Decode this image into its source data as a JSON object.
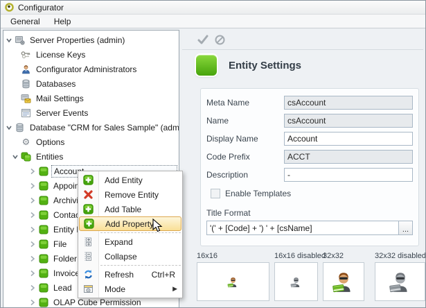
{
  "window": {
    "title": "Configurator"
  },
  "menubar": {
    "items": [
      {
        "label": "General"
      },
      {
        "label": "Help"
      }
    ]
  },
  "tree": {
    "items": [
      {
        "label": "Server Properties (admin)",
        "icon": "server-icon",
        "state": "expanded"
      },
      {
        "label": "License Keys",
        "icon": "keys-icon"
      },
      {
        "label": "Configurator Administrators",
        "icon": "admin-person-icon"
      },
      {
        "label": "Databases",
        "icon": "database-icon"
      },
      {
        "label": "Mail Settings",
        "icon": "mail-settings-icon"
      },
      {
        "label": "Server Events",
        "icon": "server-events-icon"
      },
      {
        "label": "Database \"CRM for Sales Sample\" (admin)",
        "icon": "database-icon",
        "state": "expanded"
      },
      {
        "label": "Options",
        "icon": "gear-icon"
      },
      {
        "label": "Entities",
        "icon": "entities-icon",
        "state": "expanded"
      },
      {
        "label": "Account",
        "icon": "entity-icon",
        "state": "collapsed",
        "selected": true
      },
      {
        "label": "Appoint",
        "icon": "entity-icon",
        "state": "collapsed"
      },
      {
        "label": "Archivin",
        "icon": "entity-icon",
        "state": "collapsed"
      },
      {
        "label": "Contac",
        "icon": "entity-icon",
        "state": "collapsed"
      },
      {
        "label": "Entity P",
        "icon": "entity-icon",
        "state": "collapsed"
      },
      {
        "label": "File",
        "icon": "entity-icon",
        "state": "collapsed"
      },
      {
        "label": "Folder",
        "icon": "entity-icon",
        "state": "collapsed"
      },
      {
        "label": "Invoice",
        "icon": "entity-icon",
        "state": "collapsed"
      },
      {
        "label": "Lead",
        "icon": "entity-icon",
        "state": "collapsed"
      },
      {
        "label": "OLAP Cube Permission",
        "icon": "entity-icon",
        "state": "collapsed"
      }
    ]
  },
  "context_menu": {
    "items": [
      {
        "label": "Add Entity",
        "icon": "add-icon"
      },
      {
        "label": "Remove Entity",
        "icon": "remove-icon"
      },
      {
        "label": "Add Table",
        "icon": "add-icon"
      },
      {
        "label": "Add Property",
        "icon": "add-icon",
        "highlighted": true
      },
      {
        "label": "Expand",
        "icon": "expand-tree-icon"
      },
      {
        "label": "Collapse",
        "icon": "collapse-tree-icon"
      },
      {
        "label": "Refresh",
        "icon": "refresh-icon",
        "shortcut": "Ctrl+R"
      },
      {
        "label": "Mode",
        "icon": "mode-icon",
        "submenu_arrow": "▶"
      }
    ]
  },
  "panel": {
    "toolbar": {
      "apply_icon": "check-icon",
      "cancel_icon": "ban-icon"
    },
    "title": "Entity Settings",
    "fields": [
      {
        "label": "Meta Name",
        "value": "csAccount",
        "disabled": true
      },
      {
        "label": "Name",
        "value": "csAccount",
        "disabled": true
      },
      {
        "label": "Display Name",
        "value": "Account",
        "disabled": false
      },
      {
        "label": "Code Prefix",
        "value": "ACCT",
        "disabled": true
      },
      {
        "label": "Description",
        "value": "-",
        "disabled": false
      }
    ],
    "enable_templates": {
      "label": "Enable Templates",
      "checked": false
    },
    "title_format": {
      "label": "Title Format",
      "value": "'(' + [Code] + ') ' + [csName]",
      "button": "..."
    },
    "icon_previews": [
      {
        "label": "16x16"
      },
      {
        "label": "16x16 disabled"
      },
      {
        "label": "32x32"
      },
      {
        "label": "32x32 disabled"
      }
    ]
  },
  "colors": {
    "entity_green": "#53b112",
    "menu_highlight": "#f9df96",
    "menu_highlight_border": "#dca74e",
    "panel_bg": "#eef1f4",
    "disabled_field_bg": "#e7eaed"
  }
}
